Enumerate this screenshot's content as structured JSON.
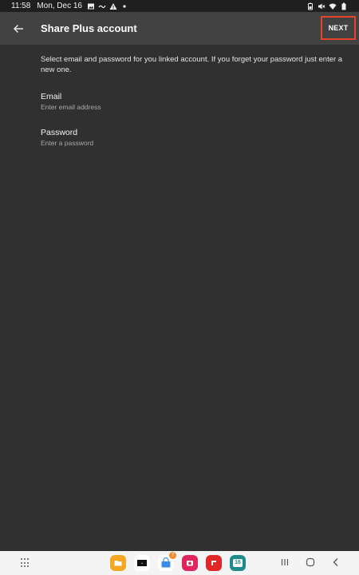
{
  "status_bar": {
    "time": "11:58",
    "date": "Mon, Dec 16",
    "left_icons": [
      "image-icon",
      "tilde-icon",
      "warning-icon",
      "dot-icon"
    ],
    "right_icons": [
      "battery-saver-icon",
      "mute-icon",
      "wifi-icon",
      "battery-icon"
    ]
  },
  "toolbar": {
    "title": "Share Plus account",
    "next_label": "NEXT",
    "next_highlight_color": "#e5462b"
  },
  "content": {
    "instructions": "Select email and password for you linked account. If you forget your password just enter a new one.",
    "email": {
      "label": "Email",
      "hint": "Enter email address"
    },
    "password": {
      "label": "Password",
      "hint": "Enter a password"
    }
  },
  "nav_bar": {
    "dock_apps": [
      {
        "name": "files-app-icon",
        "color": "#f5a623"
      },
      {
        "name": "black-app-icon",
        "color": "#111111"
      },
      {
        "name": "store-app-icon",
        "color": "#3b8ee8",
        "badge": "7"
      },
      {
        "name": "camera-app-icon",
        "color": "#e0245e"
      },
      {
        "name": "flipboard-app-icon",
        "color": "#e12828"
      },
      {
        "name": "calendar-app-icon",
        "color": "#1e8c8c",
        "text": "16"
      }
    ],
    "buttons": [
      "recents-icon",
      "home-icon",
      "back-nav-icon"
    ]
  }
}
